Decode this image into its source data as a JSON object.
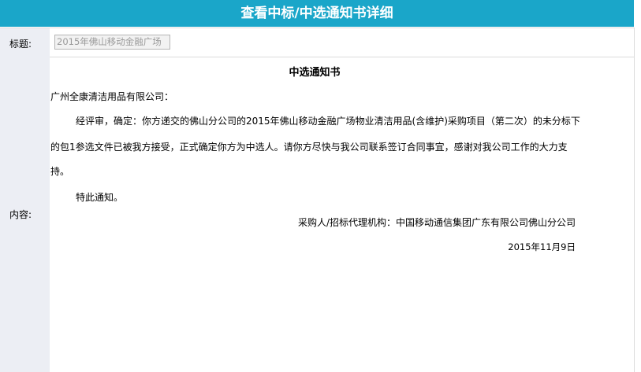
{
  "header": {
    "title": "查看中标/中选通知书详细"
  },
  "form": {
    "title_label": "标题:",
    "title_value": "2015年佛山移动金融广场",
    "content_label": "内容:"
  },
  "notice": {
    "heading": "中选通知书",
    "recipient": "广州全康清洁用品有限公司：",
    "body_line1": "经评审，确定：你方递交的佛山分公司的2015年佛山移动金融广场物业清洁用品(含维护)采购项目（第二次）的未分标下",
    "body_line2": "的包1参选文件已被我方接受，正式确定你方为中选人。请你方尽快与我公司联系签订合同事宜，感谢对我公司工作的大力支",
    "body_line3": "持。",
    "closing": "特此通知。",
    "signer": "采购人/招标代理机构：中国移动通信集团广东有限公司佛山分公司",
    "date": "2015年11月9日"
  }
}
